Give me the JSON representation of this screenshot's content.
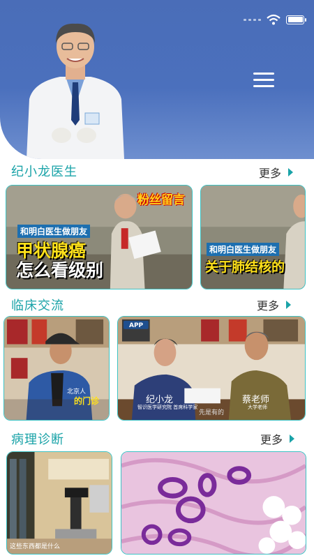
{
  "status": {
    "icons": [
      "signal-dots-icon",
      "wifi-icon",
      "battery-icon"
    ]
  },
  "header": {
    "menu_icon": "hamburger-menu-icon"
  },
  "sections": {
    "doctor": {
      "title": "纪小龙医生",
      "more": "更多"
    },
    "clinical": {
      "title": "临床交流",
      "more": "更多"
    },
    "pathology": {
      "title": "病理诊断",
      "more": "更多"
    }
  },
  "doctor_videos": [
    {
      "banner": "和明白医生做朋友",
      "headline1": "甲状腺癌",
      "headline2": "怎么看级别",
      "tag": "粉丝留言"
    },
    {
      "banner": "和明白医生做朋友",
      "headline1": "关于肺结核的"
    }
  ],
  "clinical_videos": [
    {
      "caption": "北京人",
      "caption2": "的门诊"
    },
    {
      "logo": "APP",
      "name1": "纪小龙",
      "sub1": "智识医学研究院 首席科学家",
      "name2": "蔡老师",
      "sub2": "大学老师",
      "subtitle": "先是有的"
    }
  ],
  "pathology_videos": [
    {
      "caption": "这些东西都是什么"
    },
    {
      "caption": ""
    }
  ],
  "colors": {
    "accent": "#1aa3a8",
    "header": "#4a6db8",
    "card_border": "#3cc3c5"
  }
}
